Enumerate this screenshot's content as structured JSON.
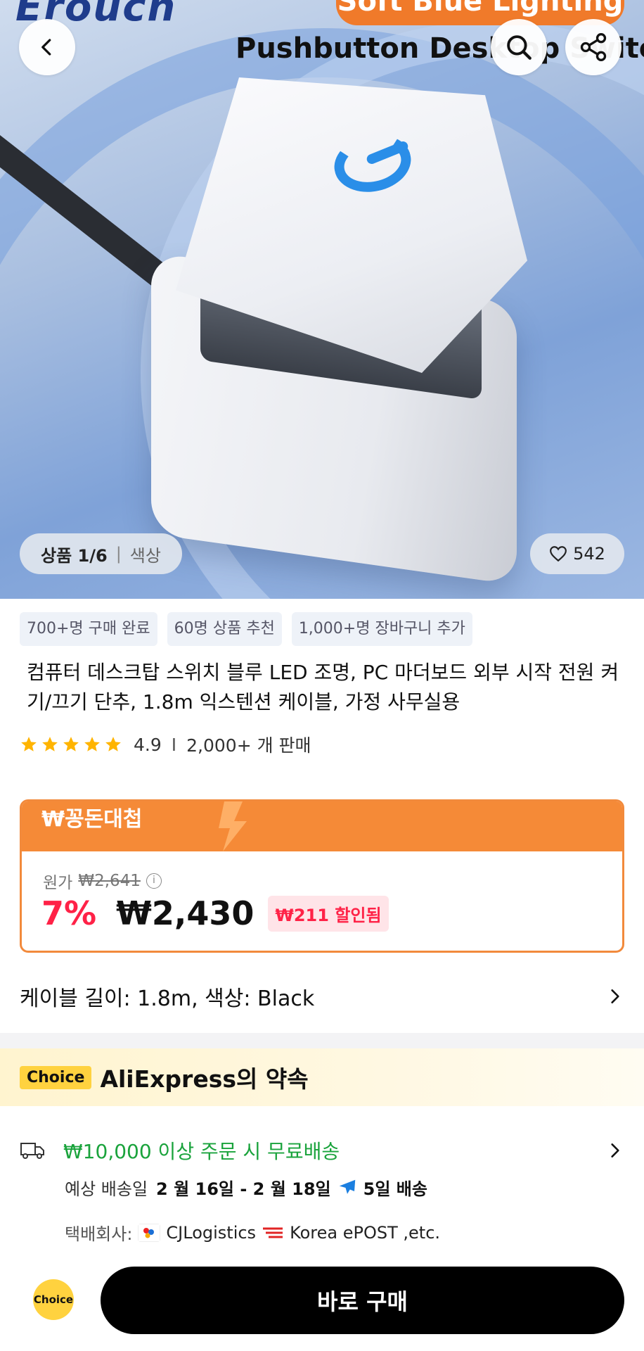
{
  "hero": {
    "brand": "Erouch",
    "banner_top": "Soft Blue Lighting",
    "banner_title": "Pushbutton Desktop Switch",
    "pager_count": "상품 1/6",
    "pager_color": "색상",
    "likes": "542"
  },
  "icons": {
    "back": "chevron-left-icon",
    "search": "search-icon",
    "share": "share-icon",
    "heart": "heart-icon"
  },
  "tags": [
    "700+명 구매 완료",
    "60명 상품 추천",
    "1,000+명 장바구니 추가"
  ],
  "product": {
    "title": "컴퓨터 데스크탑 스위치 블루 LED 조명, PC 마더보드 외부 시작 전원 켜기/끄기 단추, 1.8m 익스텐션 케이블, 가정 사무실용",
    "rating": "4.9",
    "sold": "2,000+ 개 판매",
    "stars": 5
  },
  "price": {
    "header": "₩꽁돈대첩",
    "original_label": "원가",
    "original_price": "₩2,641",
    "discount_pct": "7%",
    "current_price": "₩2,430",
    "saved": "₩211 할인됨"
  },
  "variant": {
    "text": "케이블 길이: 1.8m, 색상: Black"
  },
  "choice": {
    "badge": "Choice",
    "text": "AliExpress의 약속"
  },
  "shipping": {
    "free": "₩10,000 이상 주문 시 무료배송",
    "eta_label": "예상 배송일",
    "eta_dates": "2 월 16일 - 2 월 18일",
    "eta_days": "5일 배송",
    "carrier_label": "택배회사:",
    "carrier1": "CJLogistics",
    "carrier2": "Korea ePOST ,etc."
  },
  "bottom": {
    "choice_label": "Choice",
    "buy_label": "바로 구매"
  },
  "colors": {
    "accent_orange": "#f58a37",
    "discount_red": "#ff2247",
    "free_green": "#1aa33c",
    "choice_yellow": "#ffd23f"
  }
}
